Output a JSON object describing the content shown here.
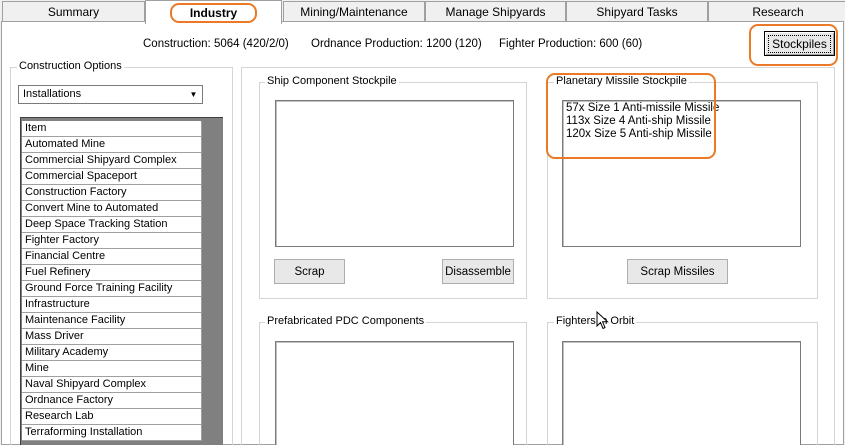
{
  "tabs": [
    {
      "label": "Summary"
    },
    {
      "label": "Industry"
    },
    {
      "label": "Mining/Maintenance"
    },
    {
      "label": "Manage Shipyards"
    },
    {
      "label": "Shipyard Tasks"
    },
    {
      "label": "Research"
    }
  ],
  "summary": {
    "construction": "Construction: 5064  (420/2/0)",
    "ordnance": "Ordnance Production: 1200  (120)",
    "fighter": "Fighter Production: 600  (60)"
  },
  "stockpiles_button": "Stockpiles",
  "construction_options": {
    "title": "Construction Options",
    "dropdown_value": "Installations",
    "items": [
      "Item",
      "Automated Mine",
      "Commercial Shipyard Complex",
      "Commercial Spaceport",
      "Construction Factory",
      "Convert Mine to Automated",
      "Deep Space Tracking Station",
      "Fighter Factory",
      "Financial Centre",
      "Fuel Refinery",
      "Ground Force Training Facility",
      "Infrastructure",
      "Maintenance Facility",
      "Mass Driver",
      "Military Academy",
      "Mine",
      "Naval Shipyard Complex",
      "Ordnance Factory",
      "Research Lab",
      "Terraforming Installation"
    ]
  },
  "ship_component": {
    "title": "Ship Component Stockpile",
    "scrap_label": "Scrap",
    "disassemble_label": "Disassemble"
  },
  "planetary_missile": {
    "title": "Planetary Missile Stockpile",
    "items": [
      "57x Size 1 Anti-missile Missile",
      "113x Size 4 Anti-ship Missile",
      "120x Size 5 Anti-ship Missile"
    ],
    "scrap_missiles_label": "Scrap Missiles"
  },
  "prefab_pdc": {
    "title": "Prefabricated PDC Components"
  },
  "fighters_orbit": {
    "title": "Fighters in Orbit"
  },
  "colors": {
    "highlight": "#ea7a26"
  }
}
